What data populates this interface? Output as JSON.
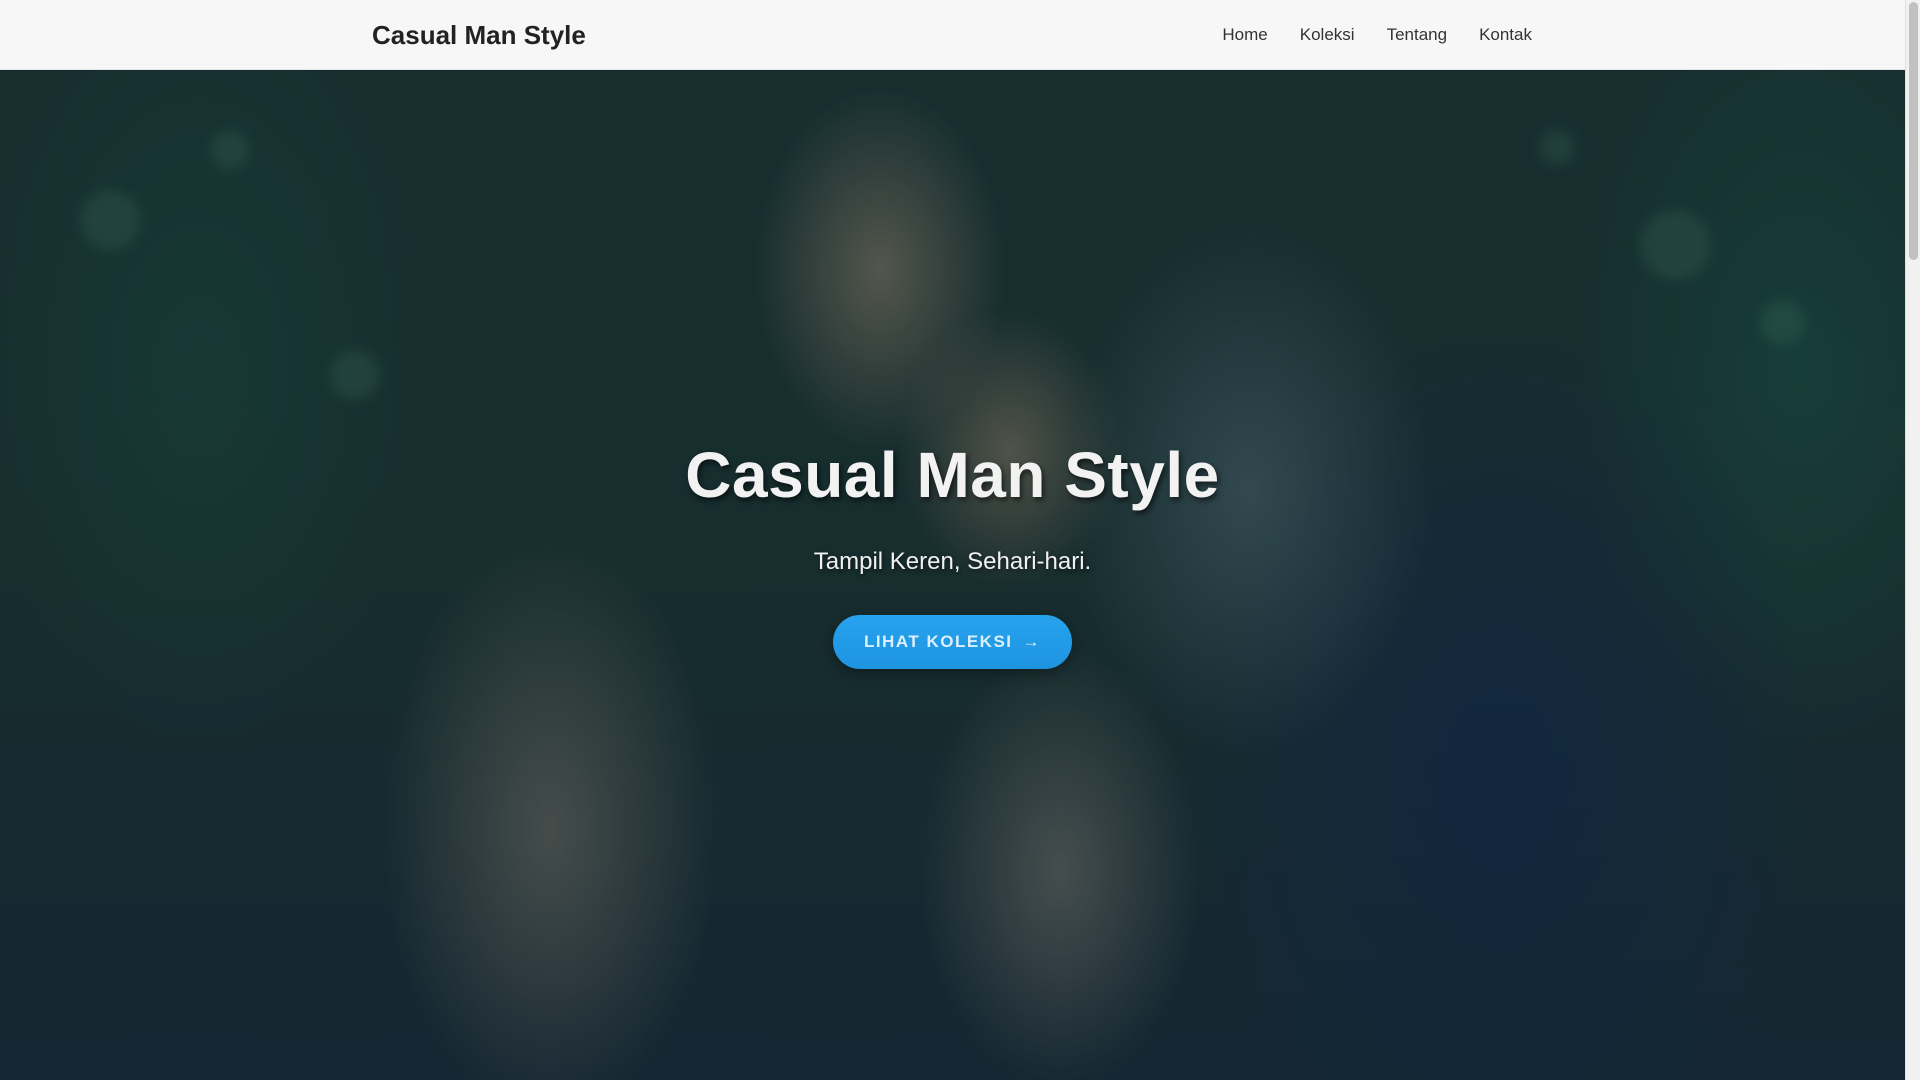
{
  "navbar": {
    "brand": "Casual Man Style",
    "links": [
      {
        "label": "Home"
      },
      {
        "label": "Koleksi"
      },
      {
        "label": "Tentang"
      },
      {
        "label": "Kontak"
      }
    ]
  },
  "hero": {
    "title": "Casual Man Style",
    "subtitle": "Tampil Keren, Sehari-hari.",
    "cta_label": "LIHAT KOLEKSI",
    "cta_arrow": "→",
    "background_description_icon": "photo-man-adjusting-shirt-collar"
  },
  "colors": {
    "navbar_bg": "#f7f7f7",
    "cta_bg": "#1e94e0",
    "hero_text": "#f2f2f2"
  }
}
